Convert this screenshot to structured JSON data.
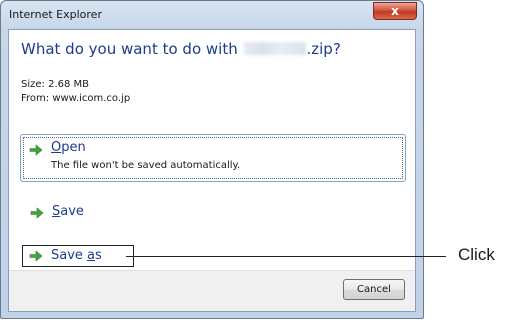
{
  "window": {
    "title": "Internet Explorer",
    "close_label": "x"
  },
  "dialog": {
    "heading_prefix": "What do you want to do with",
    "heading_suffix": ".zip?",
    "size_line": "Size: 2.68 MB",
    "from_line": "From: www.icom.co.jp"
  },
  "options": {
    "open": {
      "label_mnemonic": "O",
      "label_rest": "pen",
      "description": "The file won't be saved automatically."
    },
    "save": {
      "label_mnemonic": "S",
      "label_rest": "ave"
    },
    "save_as": {
      "label_pre": "Save ",
      "label_mnemonic": "a",
      "label_rest": "s"
    }
  },
  "footer": {
    "cancel_label": "Cancel"
  },
  "callout": {
    "text": "Click"
  },
  "colors": {
    "heading": "#1d3d8c",
    "arrow": "#3fa83a",
    "close_button": "#c9452b"
  },
  "icons": {
    "option_arrow": "green-right-arrow"
  }
}
